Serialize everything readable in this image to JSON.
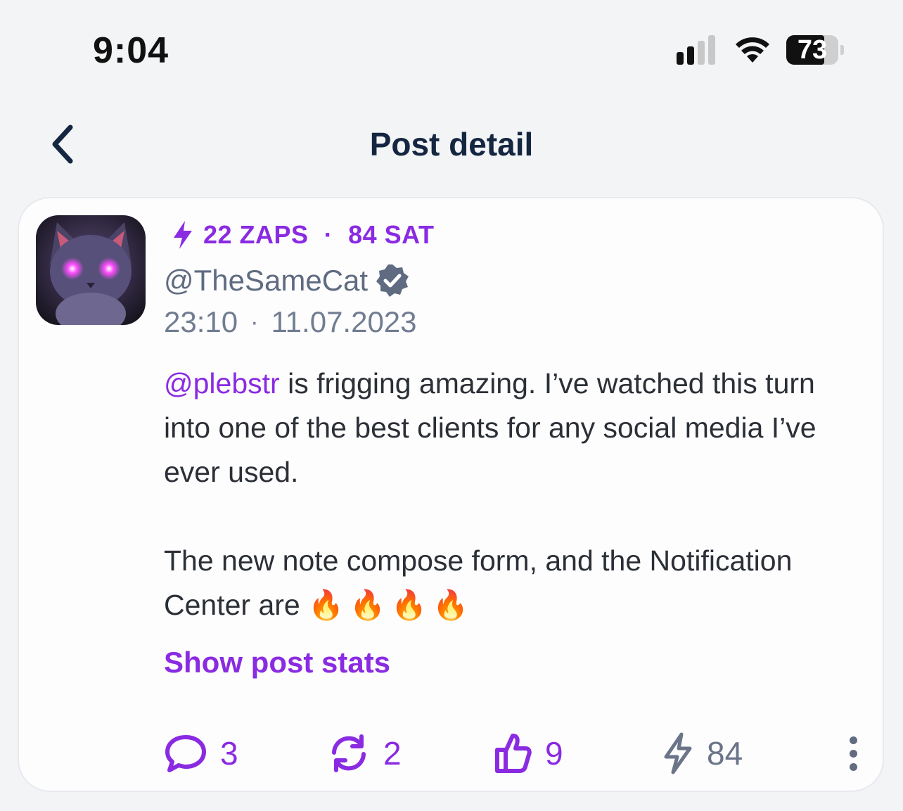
{
  "status_bar": {
    "time": "9:04",
    "battery": "73",
    "battery_level": 0.73,
    "icons": [
      "cellular-signal-icon",
      "wifi-icon",
      "battery-icon"
    ]
  },
  "header": {
    "title": "Post detail",
    "back_icon": "chevron-left-icon"
  },
  "post": {
    "zaps_label": "22 ZAPS",
    "separator": "·",
    "sats_label": "84 SAT",
    "username": "@TheSameCat",
    "verified_icon": "verified-badge-icon",
    "time": "23:10",
    "date": "11.07.2023",
    "mention": "@plebstr",
    "body_1": " is frigging amazing. I’ve watched this turn into one of the best clients for any social media I’ve ever used.",
    "body_2": "The new note compose form, and the Notification Center are ",
    "body_2_emojis": "🔥🔥🔥🔥",
    "show_stats": "Show post stats",
    "actions": {
      "replies": "3",
      "reposts": "2",
      "likes": "9",
      "zaps": "84"
    }
  },
  "colors": {
    "accent": "#8a2be2",
    "title": "#142640",
    "muted": "#717d91",
    "background": "#f3f4f6",
    "card": "#fdfdfe"
  }
}
